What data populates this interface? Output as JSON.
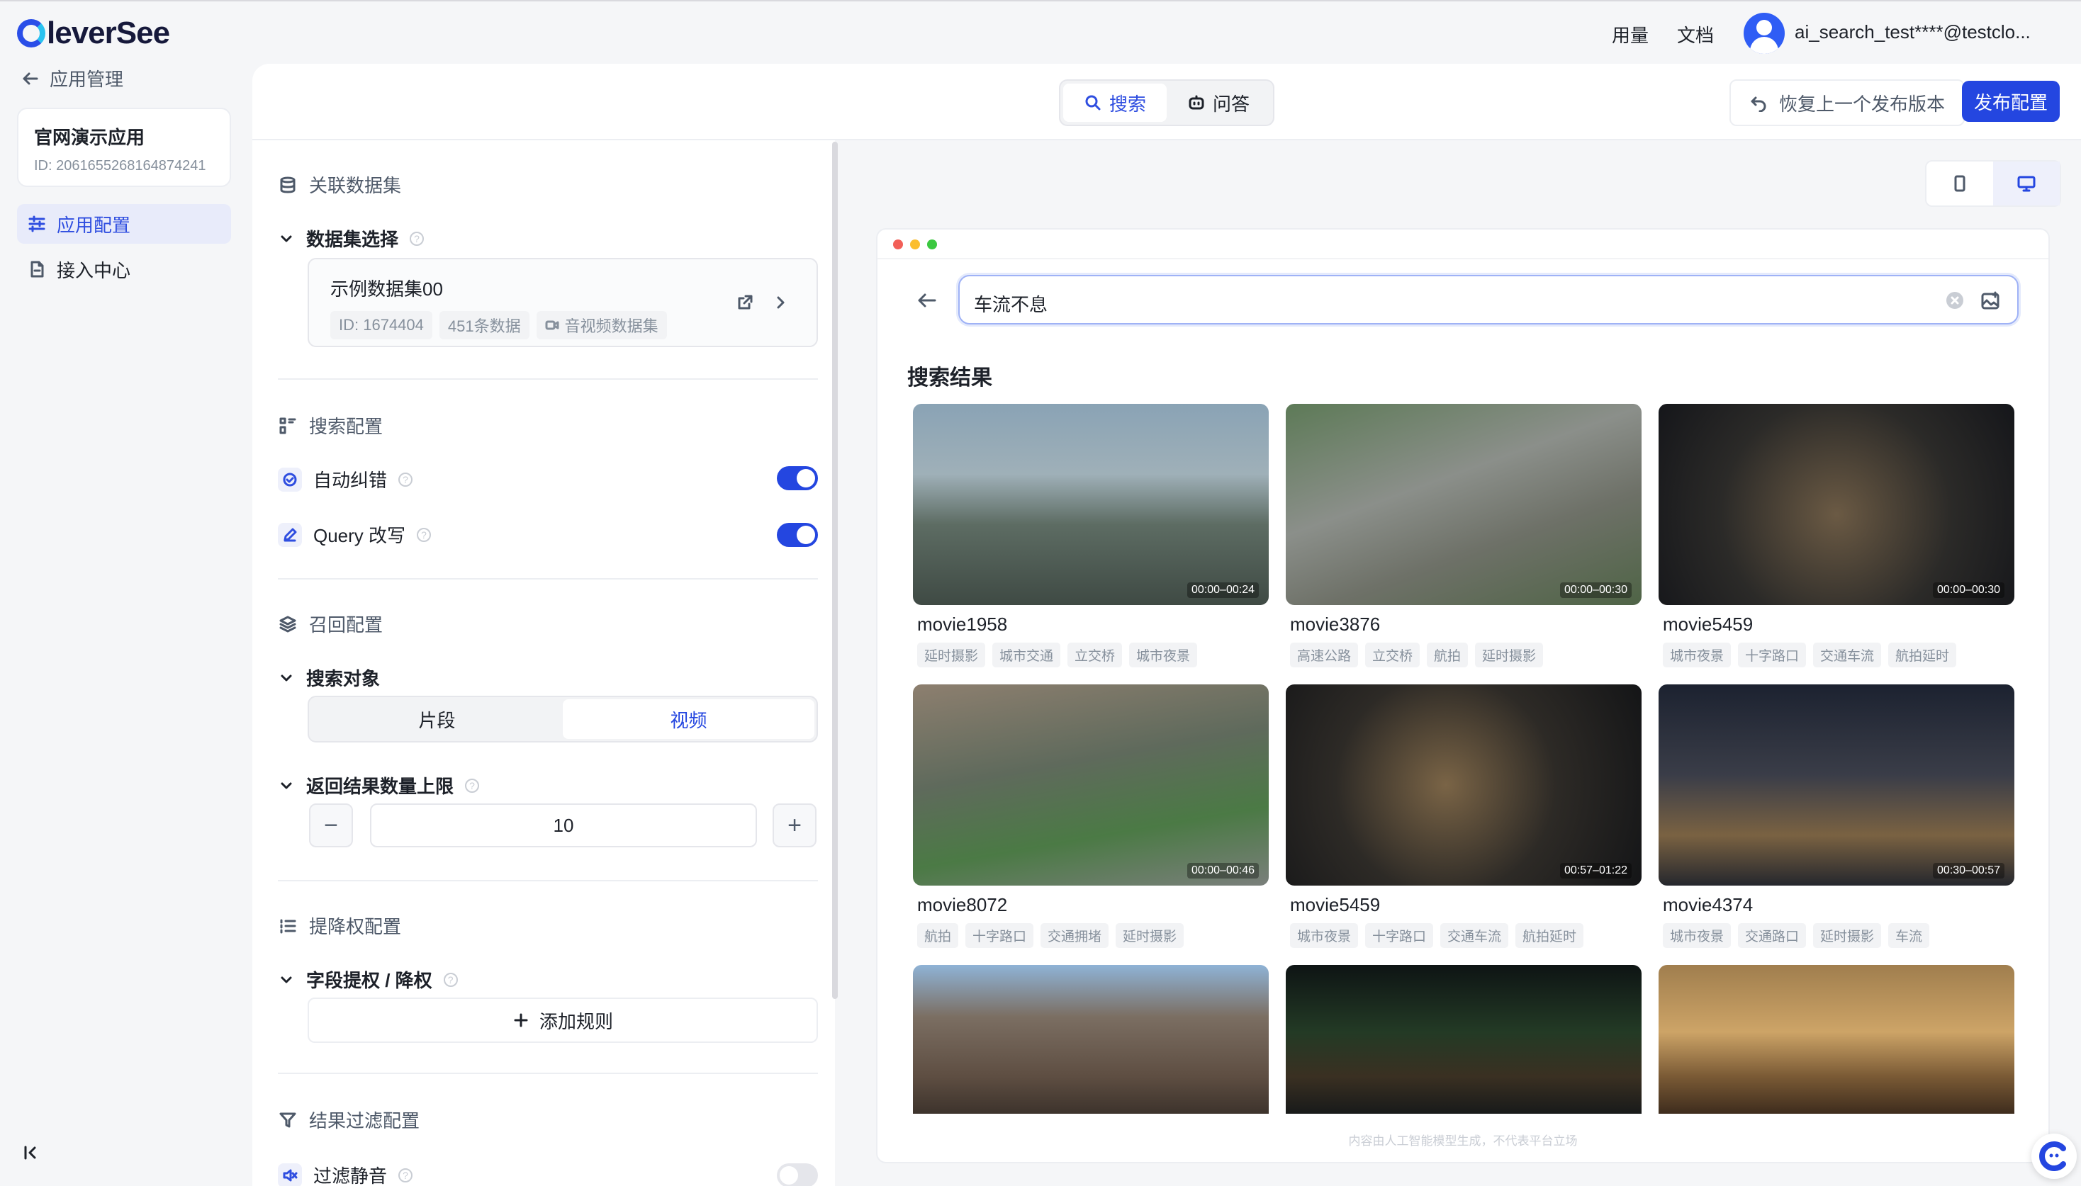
{
  "brand": {
    "name": "leverSee"
  },
  "topnav": {
    "usage": "用量",
    "docs": "文档",
    "email": "ai_search_test****@testclo..."
  },
  "sidebar": {
    "back_label": "应用管理",
    "app_name": "官网演示应用",
    "app_id": "ID: 2061655268164874241",
    "items": [
      {
        "label": "应用配置"
      },
      {
        "label": "接入中心"
      }
    ]
  },
  "header": {
    "tabs": [
      {
        "label": "搜索"
      },
      {
        "label": "问答"
      }
    ],
    "restore_label": "恢复上一个发布版本",
    "publish_label": "发布配置"
  },
  "config": {
    "dataset_section": "关联数据集",
    "dataset_select": "数据集选择",
    "dataset": {
      "name": "示例数据集00",
      "id": "ID: 1674404",
      "count": "451条数据",
      "type": "音视频数据集"
    },
    "search_section": "搜索配置",
    "auto_correct": {
      "label": "自动纠错",
      "enabled": true
    },
    "query_rewrite": {
      "label": "Query 改写",
      "enabled": true
    },
    "recall_section": "召回配置",
    "search_target": "搜索对象",
    "target_options": [
      "片段",
      "视频"
    ],
    "target_selected": "视频",
    "result_limit_label": "返回结果数量上限",
    "result_limit_value": "10",
    "boost_section": "提降权配置",
    "field_boost": "字段提权 / 降权",
    "add_rule": "添加规则",
    "filter_section": "结果过滤配置",
    "filter_silence": {
      "label": "过滤静音",
      "enabled": false
    }
  },
  "preview": {
    "query": "车流不息",
    "results_title": "搜索结果",
    "footer_note": "内容由人工智能模型生成，不代表平台立场",
    "results": [
      {
        "title": "movie1958",
        "duration": "00:00–00:24",
        "tags": [
          "延时摄影",
          "城市交通",
          "立交桥",
          "城市夜景"
        ]
      },
      {
        "title": "movie3876",
        "duration": "00:00–00:30",
        "tags": [
          "高速公路",
          "立交桥",
          "航拍",
          "延时摄影"
        ]
      },
      {
        "title": "movie5459",
        "duration": "00:00–00:30",
        "tags": [
          "城市夜景",
          "十字路口",
          "交通车流",
          "航拍延时"
        ]
      },
      {
        "title": "movie8072",
        "duration": "00:00–00:46",
        "tags": [
          "航拍",
          "十字路口",
          "交通拥堵",
          "延时摄影"
        ]
      },
      {
        "title": "movie5459",
        "duration": "00:57–01:22",
        "tags": [
          "城市夜景",
          "十字路口",
          "交通车流",
          "航拍延时"
        ]
      },
      {
        "title": "movie4374",
        "duration": "00:30–00:57",
        "tags": [
          "城市夜景",
          "交通路口",
          "延时摄影",
          "车流"
        ]
      },
      {
        "title": "",
        "duration": "",
        "tags": []
      },
      {
        "title": "",
        "duration": "",
        "tags": []
      },
      {
        "title": "",
        "duration": "",
        "tags": []
      }
    ]
  }
}
